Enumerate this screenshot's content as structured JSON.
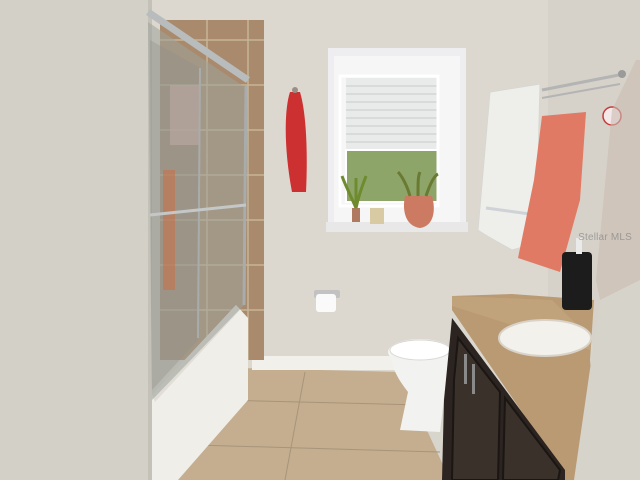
{
  "scene": {
    "description_hidden": "",
    "watermark": "Stellar MLS"
  },
  "colors": {
    "wall": "#dcd8cf",
    "wall_left": "#d2cfc6",
    "floor": "#c2ad8e",
    "vanity_wood": "#2b2420",
    "countertop": "#b99a73",
    "red_towel": "#cc3030",
    "salmon_towel": "#e07a64",
    "white_towel": "#eeeeea",
    "tile": "#a98a6c"
  }
}
